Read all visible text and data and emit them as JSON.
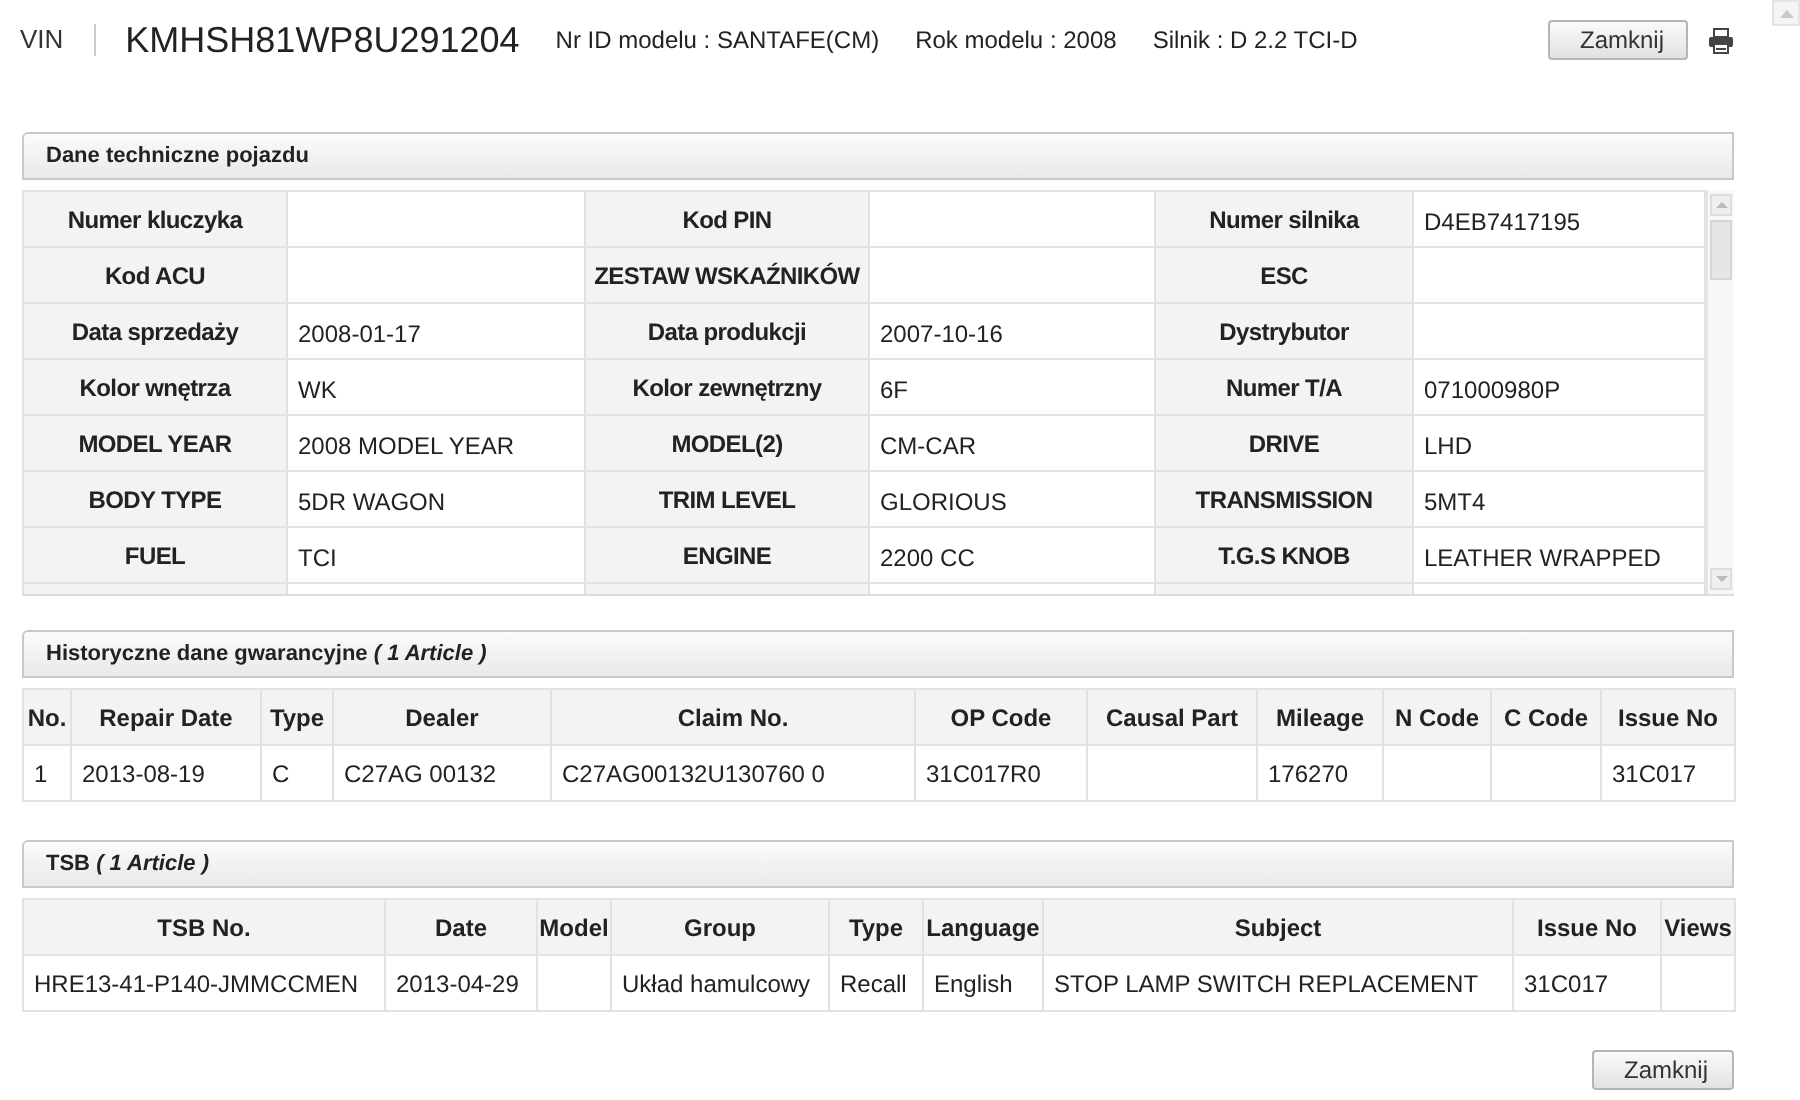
{
  "header": {
    "vin_label": "VIN",
    "vin": "KMHSH81WP8U291204",
    "info": [
      "Nr ID modelu : SANTAFE(CM)",
      "Rok modelu : 2008",
      "Silnik : D 2.2 TCI-D"
    ],
    "close_button": "Zamknij"
  },
  "vehicle_specs": {
    "title": "Dane techniczne pojazdu",
    "rows": [
      [
        {
          "label": "Numer kluczyka"
        },
        {
          "label": "Kod PIN"
        },
        {
          "label": "Numer silnika",
          "value": "D4EB7417195"
        }
      ],
      [
        {
          "label": "Kod ACU"
        },
        {
          "label": "ZESTAW WSKAŹNIKÓW"
        },
        {
          "label": "ESC"
        }
      ],
      [
        {
          "label": "Data sprzedaży",
          "value": "2008-01-17"
        },
        {
          "label": "Data produkcji",
          "value": "2007-10-16"
        },
        {
          "label": "Dystrybutor"
        }
      ],
      [
        {
          "label": "Kolor wnętrza",
          "value": "WK"
        },
        {
          "label": "Kolor zewnętrzny",
          "value": "6F"
        },
        {
          "label": "Numer T/A",
          "value": "071000980P"
        }
      ],
      [
        {
          "label": "MODEL YEAR",
          "value": "2008 MODEL YEAR"
        },
        {
          "label": "MODEL(2)",
          "value": "CM-CAR"
        },
        {
          "label": "DRIVE",
          "value": "LHD"
        }
      ],
      [
        {
          "label": "BODY TYPE",
          "value": "5DR WAGON"
        },
        {
          "label": "TRIM LEVEL",
          "value": "GLORIOUS"
        },
        {
          "label": "TRANSMISSION",
          "value": "5MT4"
        }
      ],
      [
        {
          "label": "FUEL",
          "value": "TCI"
        },
        {
          "label": "ENGINE",
          "value": "2200 CC"
        },
        {
          "label": "T.G.S KNOB",
          "value": "LEATHER WRAPPED"
        }
      ]
    ]
  },
  "warranty_history": {
    "title": "Historyczne dane gwarancyjne *( 1 Article )*",
    "columns": [
      "No.",
      "Repair Date",
      "Type",
      "Dealer",
      "Claim No.",
      "OP Code",
      "Causal Part",
      "Mileage",
      "N Code",
      "C Code",
      "Issue No"
    ],
    "rows": [
      [
        "1",
        "2013-08-19",
        "C",
        "C27AG 00132",
        "C27AG00132U130760 0",
        "31C017R0",
        null,
        "176270",
        null,
        null,
        "31C017"
      ]
    ]
  },
  "tsb": {
    "title": "TSB *( 1 Article )*",
    "columns": [
      "TSB No.",
      "Date",
      "Model",
      "Group",
      "Type",
      "Language",
      "Subject",
      "Issue No",
      "Views"
    ],
    "rows": [
      [
        "HRE13-41-P140-JMMCCMEN",
        "2013-04-29",
        null,
        "Układ hamulcowy",
        "Recall",
        "English",
        "STOP LAMP SWITCH REPLACEMENT",
        "31C017",
        null
      ]
    ]
  },
  "footer": {
    "close_button": "Zamknij"
  }
}
